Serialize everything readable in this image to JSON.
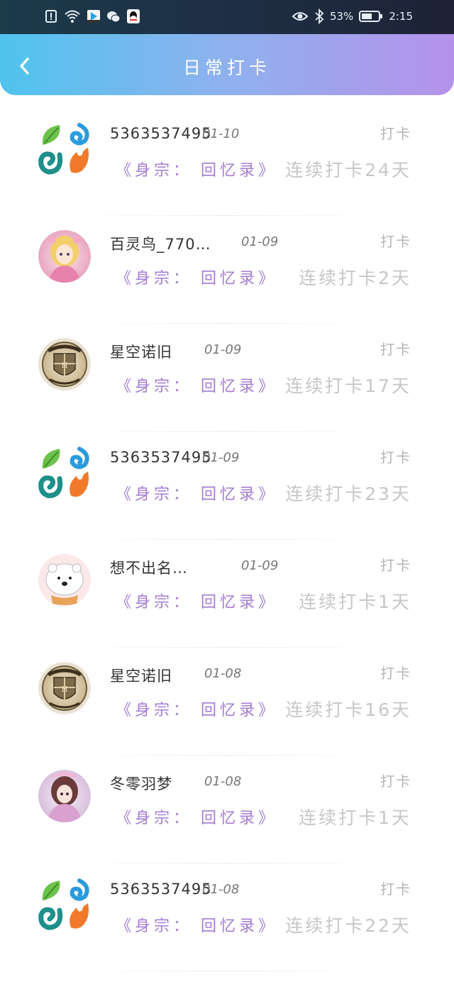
{
  "status_bar": {
    "battery": "53%",
    "time": "2:15",
    "left_icons": [
      "alert-icon",
      "wifi-icon",
      "video-app-icon",
      "wechat-icon",
      "qq-icon"
    ],
    "right_icons": [
      "eye-icon",
      "bluetooth-icon",
      "battery-icon"
    ]
  },
  "header": {
    "title": "日常打卡",
    "back_icon": "chevron-left-icon"
  },
  "colors": {
    "header_gradient_start": "#4fc4ee",
    "header_gradient_end": "#b592ea",
    "book_text": "#a47bd4",
    "streak_text": "#c7c7c7"
  },
  "items": [
    {
      "avatar": "four-element-logo",
      "name": "5363537495",
      "date": "01-10",
      "action": "打卡",
      "book": "《身宗： 回忆录》",
      "streak": "连续打卡24天"
    },
    {
      "avatar": "anime-girl-pink",
      "name": "百灵鸟_770…",
      "date": "01-09",
      "action": "打卡",
      "book": "《身宗： 回忆录》",
      "streak": "连续打卡2天"
    },
    {
      "avatar": "hogwarts-crest",
      "name": "星空诺旧",
      "date": "01-09",
      "action": "打卡",
      "book": "《身宗： 回忆录》",
      "streak": "连续打卡17天"
    },
    {
      "avatar": "four-element-logo",
      "name": "5363537495",
      "date": "01-09",
      "action": "打卡",
      "book": "《身宗： 回忆录》",
      "streak": "连续打卡23天"
    },
    {
      "avatar": "white-bear",
      "name": "想不出名…",
      "date": "01-09",
      "action": "打卡",
      "book": "《身宗： 回忆录》",
      "streak": "连续打卡1天"
    },
    {
      "avatar": "hogwarts-crest",
      "name": "星空诺旧",
      "date": "01-08",
      "action": "打卡",
      "book": "《身宗： 回忆录》",
      "streak": "连续打卡16天"
    },
    {
      "avatar": "anime-girl-purple",
      "name": "冬零羽梦",
      "date": "01-08",
      "action": "打卡",
      "book": "《身宗： 回忆录》",
      "streak": "连续打卡1天"
    },
    {
      "avatar": "four-element-logo",
      "name": "5363537495",
      "date": "01-08",
      "action": "打卡",
      "book": "《身宗： 回忆录》",
      "streak": "连续打卡22天"
    }
  ]
}
